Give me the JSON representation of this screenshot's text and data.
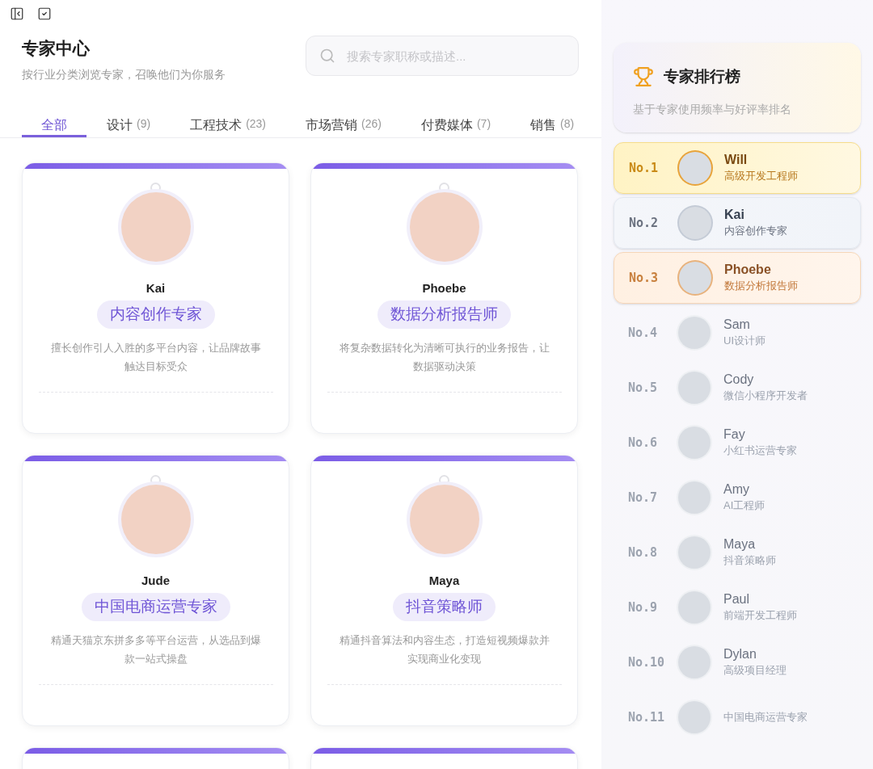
{
  "header": {
    "title": "专家中心",
    "subtitle": "按行业分类浏览专家，召唤他们为你服务"
  },
  "search": {
    "placeholder": "搜索专家职称或描述..."
  },
  "tabs": [
    {
      "label": "全部",
      "selected": true
    },
    {
      "label": "设计",
      "count": "(9)",
      "selected": false
    },
    {
      "label": "工程技术",
      "count": "(23)",
      "selected": false
    },
    {
      "label": "市场营销",
      "count": "(26)",
      "selected": false
    },
    {
      "label": "付费媒体",
      "count": "(7)",
      "selected": false
    },
    {
      "label": "销售",
      "count": "(8)",
      "selected": false
    }
  ],
  "experts": [
    {
      "kind": "full",
      "name": "Kai",
      "title": "内容创作专家",
      "description": "擅长创作引人入胜的多平台内容，让品牌故事触达目标受众"
    },
    {
      "kind": "full",
      "name": "Phoebe",
      "title": "数据分析报告师",
      "description": "将复杂数据转化为清晰可执行的业务报告，让数据驱动决策"
    },
    {
      "kind": "full",
      "name": "Jude",
      "title": "中国电商运营专家",
      "description": "精通天猫京东拼多多等平台运营，从选品到爆款一站式操盘"
    },
    {
      "kind": "full",
      "name": "Maya",
      "title": "抖音策略师",
      "description": "精通抖音算法和内容生态，打造短视频爆款并实现商业化变现"
    },
    {
      "kind": "cut_off"
    },
    {
      "kind": "cut_off"
    }
  ],
  "leaderboard": {
    "title": "专家排行榜",
    "subtitle": "基于专家使用频率与好评率排名",
    "items": [
      {
        "rank": "No.1",
        "name": "Will",
        "title": "高级开发工程师",
        "kind": "gold"
      },
      {
        "rank": "No.2",
        "name": "Kai",
        "title": "内容创作专家",
        "kind": "silver"
      },
      {
        "rank": "No.3",
        "name": "Phoebe",
        "title": "数据分析报告师",
        "kind": "bronze"
      },
      {
        "rank": "No.4",
        "name": "Sam",
        "title": "UI设计师",
        "kind": "plain"
      },
      {
        "rank": "No.5",
        "name": "Cody",
        "title": "微信小程序开发者",
        "kind": "plain"
      },
      {
        "rank": "No.6",
        "name": "Fay",
        "title": "小红书运营专家",
        "kind": "plain"
      },
      {
        "rank": "No.7",
        "name": "Amy",
        "title": "AI工程师",
        "kind": "plain"
      },
      {
        "rank": "No.8",
        "name": "Maya",
        "title": "抖音策略师",
        "kind": "plain"
      },
      {
        "rank": "No.9",
        "name": "Paul",
        "title": "前端开发工程师",
        "kind": "plain"
      },
      {
        "rank": "No.10",
        "name": "Dylan",
        "title": "高级项目经理",
        "kind": "plain"
      },
      {
        "rank": "No.11",
        "title": "中国电商运营专家",
        "kind": "plain"
      }
    ]
  }
}
